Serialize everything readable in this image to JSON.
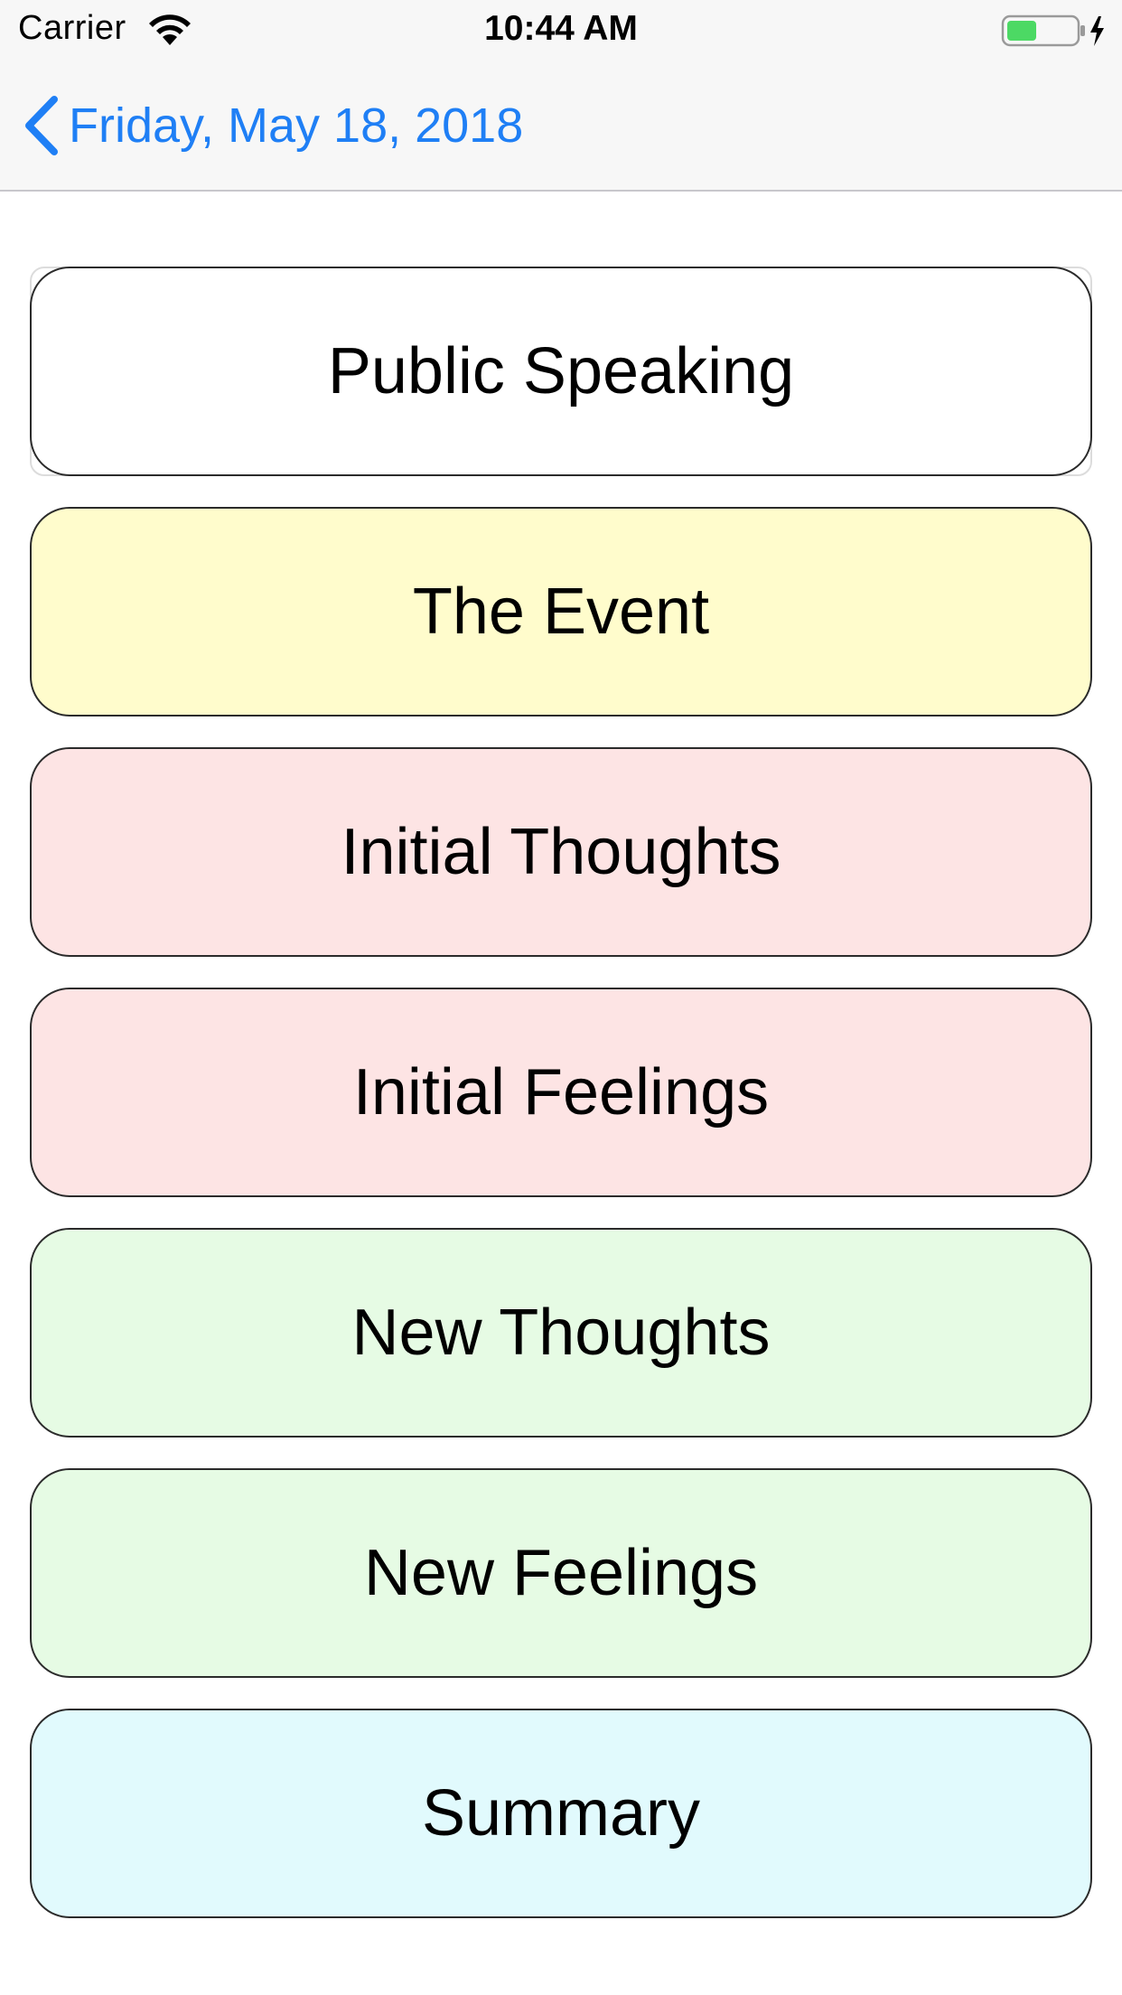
{
  "status_bar": {
    "carrier": "Carrier",
    "time": "10:44 AM",
    "battery_color": "#4cd964"
  },
  "nav": {
    "back_label": "Friday, May 18, 2018",
    "accent_color": "#1f7ff5"
  },
  "sections": [
    {
      "label": "Public Speaking",
      "color": "#ffffff"
    },
    {
      "label": "The Event",
      "color": "#fffccc"
    },
    {
      "label": "Initial Thoughts",
      "color": "#fde4e4"
    },
    {
      "label": "Initial Feelings",
      "color": "#fde4e4"
    },
    {
      "label": "New Thoughts",
      "color": "#e6fbe4"
    },
    {
      "label": "New Feelings",
      "color": "#e6fbe4"
    },
    {
      "label": "Summary",
      "color": "#e1fafd"
    }
  ]
}
